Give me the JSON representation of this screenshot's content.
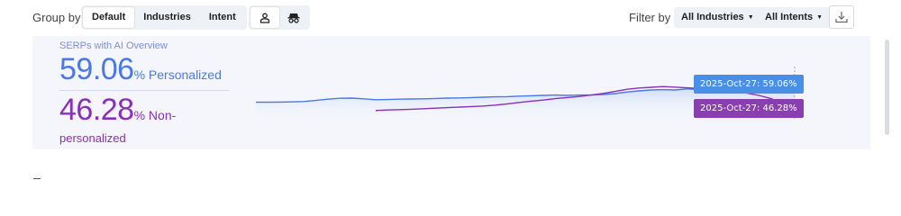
{
  "toolbar": {
    "group_by_label": "Group by",
    "group_options": [
      "Default",
      "Industries",
      "Intent"
    ],
    "active_group": "Default",
    "view_icons": [
      "person-icon",
      "incognito-icon"
    ],
    "filter_by_label": "Filter by",
    "industries_dropdown": "All Industries",
    "intents_dropdown": "All Intents",
    "download_icon": "download-icon"
  },
  "panel": {
    "title": "SERPs with AI Overview",
    "personalized_value": "59.06",
    "personalized_unit": "% Personalized",
    "non_personalized_value": "46.28",
    "non_personalized_unit": "% Non-",
    "non_personalized_unit_2": "personalized"
  },
  "tooltips": {
    "personalized": "2025-Oct-27: 59.06%",
    "non_personalized": "2025-Oct-27: 46.28%"
  },
  "colors": {
    "personalized": "#4a78e6",
    "non_personalized": "#8a2fb8",
    "panel_bg": "#f4f6fb"
  },
  "chart_data": {
    "type": "line",
    "series": [
      {
        "name": "Personalized",
        "values": [
          50.2,
          50.2,
          50.3,
          50.4,
          50.6,
          51.2,
          51.9,
          52.4,
          52.5,
          52.1,
          51.6,
          51.7,
          51.9,
          52.0,
          52.1,
          52.3,
          52.5,
          52.6,
          52.8,
          53.0,
          53.2,
          53.3,
          53.6,
          53.8,
          54.0,
          54.2,
          54.0,
          54.2,
          54.2,
          54.5,
          55.0,
          55.9,
          56.5,
          57.0,
          57.2,
          57.0,
          57.6,
          57.3,
          57.4,
          57.6,
          57.7,
          57.6,
          57.8,
          58.2,
          58.6,
          59.06
        ]
      },
      {
        "name": "Non-personalized",
        "values": [
          null,
          null,
          null,
          null,
          null,
          null,
          null,
          null,
          null,
          null,
          45.6,
          45.9,
          46.1,
          46.3,
          46.6,
          46.9,
          47.2,
          47.5,
          47.8,
          48.1,
          48.6,
          49.3,
          50.1,
          50.8,
          51.4,
          52.2,
          52.8,
          53.4,
          54.2,
          55.1,
          56.2,
          57.4,
          58.1,
          58.5,
          58.9,
          58.6,
          58.2,
          57.9,
          57.4,
          56.9,
          56.2,
          55.3,
          54.0,
          52.3,
          49.8,
          46.28
        ]
      }
    ]
  }
}
